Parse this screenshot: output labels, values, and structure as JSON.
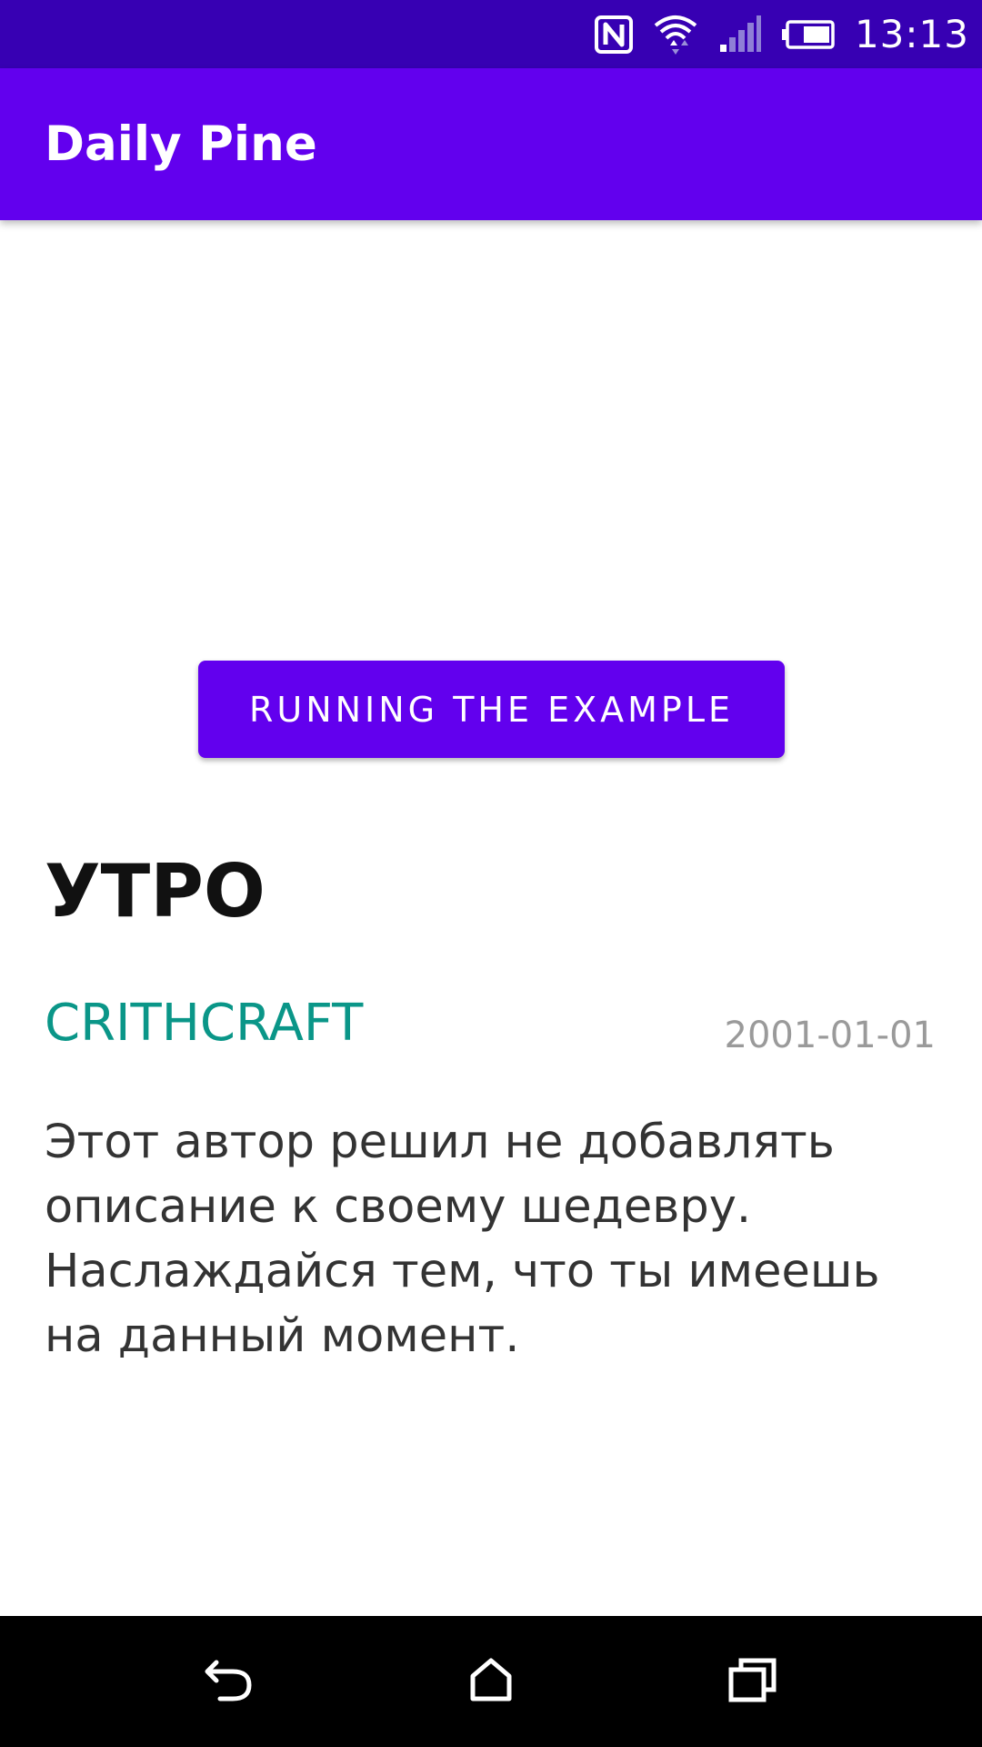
{
  "status_bar": {
    "time": "13:13",
    "icons": [
      "nfc-icon",
      "wifi-icon",
      "cell-signal-icon",
      "battery-icon"
    ]
  },
  "app_bar": {
    "title": "Daily Pine"
  },
  "main": {
    "button_label": "RUNNING THE EXAMPLE",
    "title": "УТРО",
    "author": "CRITHCRAFT",
    "date": "2001-01-01",
    "description": "Этот автор решил не добавлять описание к своему шедевру. Наслаждайся тем, что ты имеешь на данный момент."
  },
  "nav_bar": {
    "icons": [
      "back-icon",
      "home-icon",
      "recents-icon"
    ]
  },
  "colors": {
    "status_bar": "#3700b3",
    "app_bar": "#6200ee",
    "button": "#6200ee",
    "author": "#0a9688",
    "date": "#9a9a9a"
  }
}
